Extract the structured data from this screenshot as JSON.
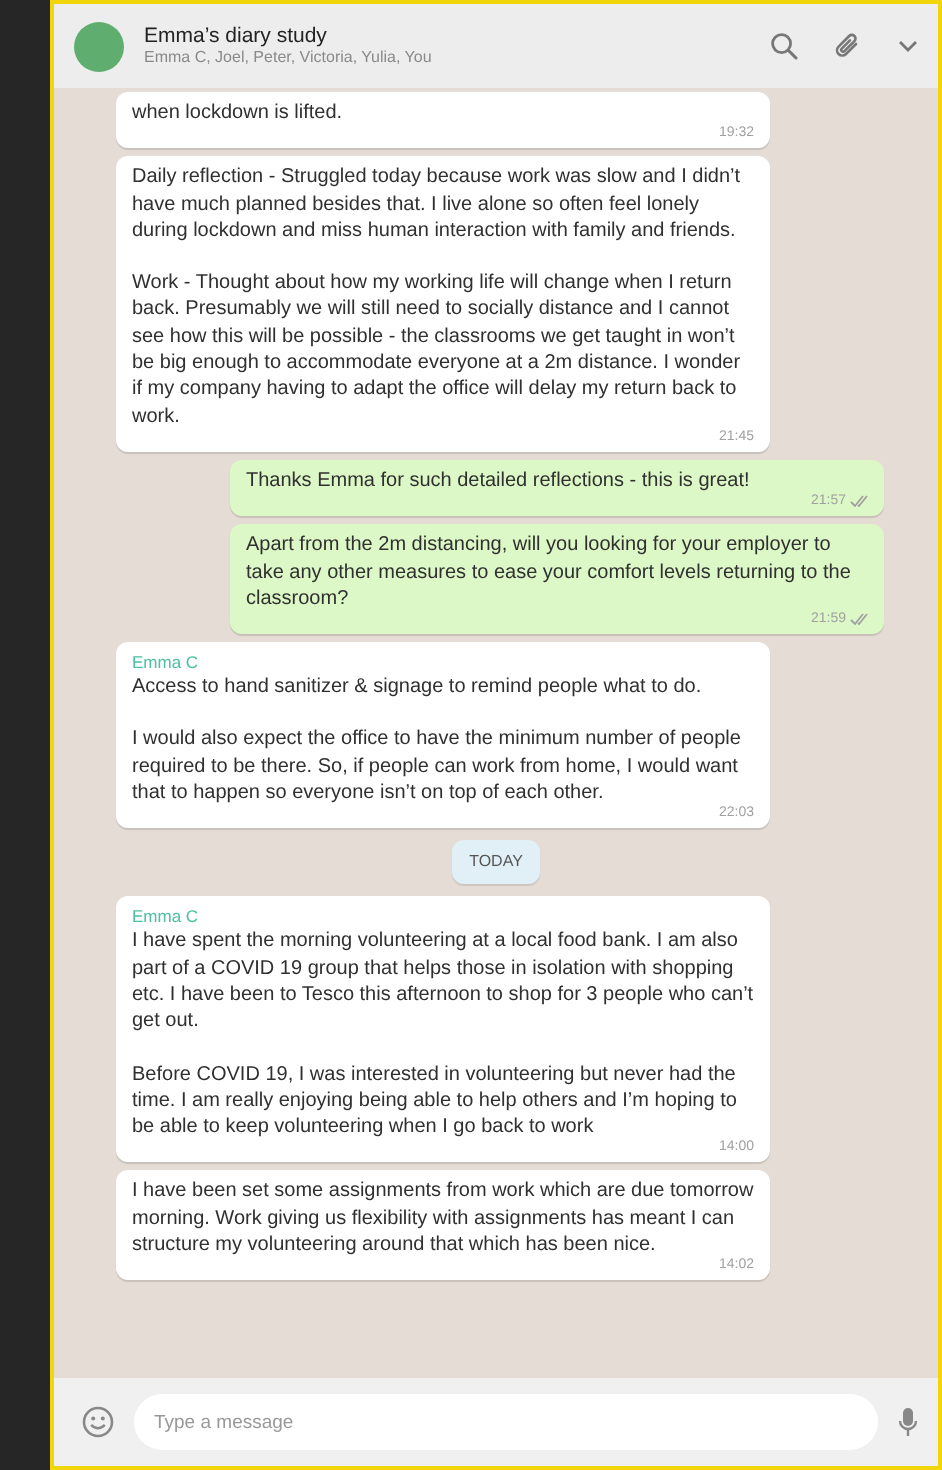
{
  "chat": {
    "title": "Emma’s diary study",
    "participants": "Emma C, Joel, Peter, Victoria, Yulia, You"
  },
  "messages": [
    {
      "kind": "incoming",
      "paragraphs": [
        "when lockdown is lifted."
      ],
      "time": "19:32"
    },
    {
      "kind": "incoming",
      "paragraphs": [
        "Daily reflection - Struggled today because work was slow and I didn’t have much planned besides that. I live alone so often feel lonely during lockdown and miss human interaction with family and friends.",
        "Work - Thought about how my working life will change when I return back. Presumably we will still need to socially distance and I cannot see how this will be possible - the classrooms we get taught in won’t be big enough to accommodate everyone at a 2m distance. I wonder if my company having to adapt the office will delay my return back to work."
      ],
      "time": "21:45"
    },
    {
      "kind": "outgoing",
      "paragraphs": [
        "Thanks Emma for such detailed reflections - this is great!"
      ],
      "time": "21:57",
      "read": false
    },
    {
      "kind": "outgoing",
      "paragraphs": [
        "Apart from the 2m distancing, will you looking for your employer to take any other measures to ease your comfort levels returning to the classroom?"
      ],
      "time": "21:59",
      "read": false
    },
    {
      "kind": "incoming",
      "sender": "Emma C",
      "paragraphs": [
        "Access to hand sanitizer & signage to remind people what to do.",
        "I would also expect the office to have the minimum number of people required to be there. So, if people can work from home, I would want that to happen so everyone isn’t on top of each other."
      ],
      "time": "22:03"
    },
    {
      "kind": "date",
      "label": "TODAY"
    },
    {
      "kind": "incoming",
      "sender": "Emma C",
      "paragraphs": [
        "I have spent the morning volunteering at a local food bank. I am also part of a COVID 19 group that helps those in isolation with shopping etc. I have been to Tesco this afternoon to shop for 3 people who can’t get out.",
        "Before COVID 19, I was interested in volunteering but never had the time. I am really enjoying being able to help others and I’m hoping to be able to keep volunteering when I go back to work"
      ],
      "time": "14:00"
    },
    {
      "kind": "incoming",
      "paragraphs": [
        "I have been set some assignments from work which are due tomorrow morning. Work giving us flexibility with assignments has meant I can structure my volunteering around that which has been nice."
      ],
      "time": "14:02"
    }
  ],
  "composer": {
    "placeholder": "Type a message"
  }
}
